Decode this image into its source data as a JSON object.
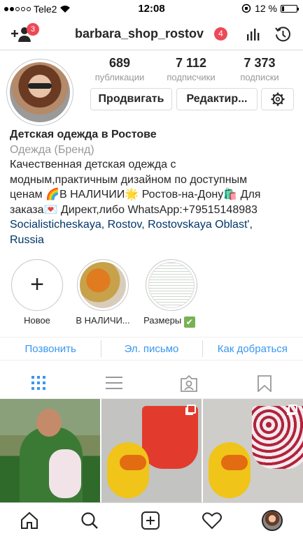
{
  "status_bar": {
    "carrier": "Tele2",
    "time": "12:08",
    "battery": "12 %"
  },
  "header": {
    "username": "barbara_shop_rostov",
    "add_user_badge": "3",
    "username_badge": "4"
  },
  "stats": {
    "posts_count": "689",
    "posts_label": "публикации",
    "followers_count": "7 112",
    "followers_label": "подписчики",
    "following_count": "7 373",
    "following_label": "подписки"
  },
  "actions": {
    "promote_label": "Продвигать",
    "edit_label": "Редактир..."
  },
  "bio": {
    "name": "Детская одежда в Ростове",
    "category": "Одежда (Бренд)",
    "line1": "Качественная детская одежда с",
    "line2": "модным,практичным дизайном по доступным",
    "line3": "ценам 🌈В НАЛИЧИИ🌟 Ростов-на-Дону🛍️ Для",
    "line4": "заказа💌 Директ,либо WhatsApp:+79515148983",
    "address_line1": "Socialisticheskaya, Rostov, Rostovskaya Oblast',",
    "address_line2": "Russia"
  },
  "highlights": [
    {
      "label": "Новое"
    },
    {
      "label": "В НАЛИЧИ..."
    },
    {
      "label": "Размеры"
    }
  ],
  "contact": {
    "call": "Позвонить",
    "email": "Эл. письмо",
    "directions": "Как добраться"
  },
  "icons": {
    "add_user": "add-user-icon",
    "stats": "insights-bar-chart-icon",
    "history": "history-icon",
    "settings": "gear-icon",
    "grid_view": "grid-icon",
    "list_view": "list-icon",
    "tagged": "tagged-icon",
    "saved": "bookmark-icon",
    "home": "home-icon",
    "search": "search-icon",
    "new_post": "new-post-icon",
    "activity": "heart-icon"
  },
  "colors": {
    "link_blue": "#3897f0",
    "badge_red": "#ed4956",
    "address_blue": "#003569"
  }
}
